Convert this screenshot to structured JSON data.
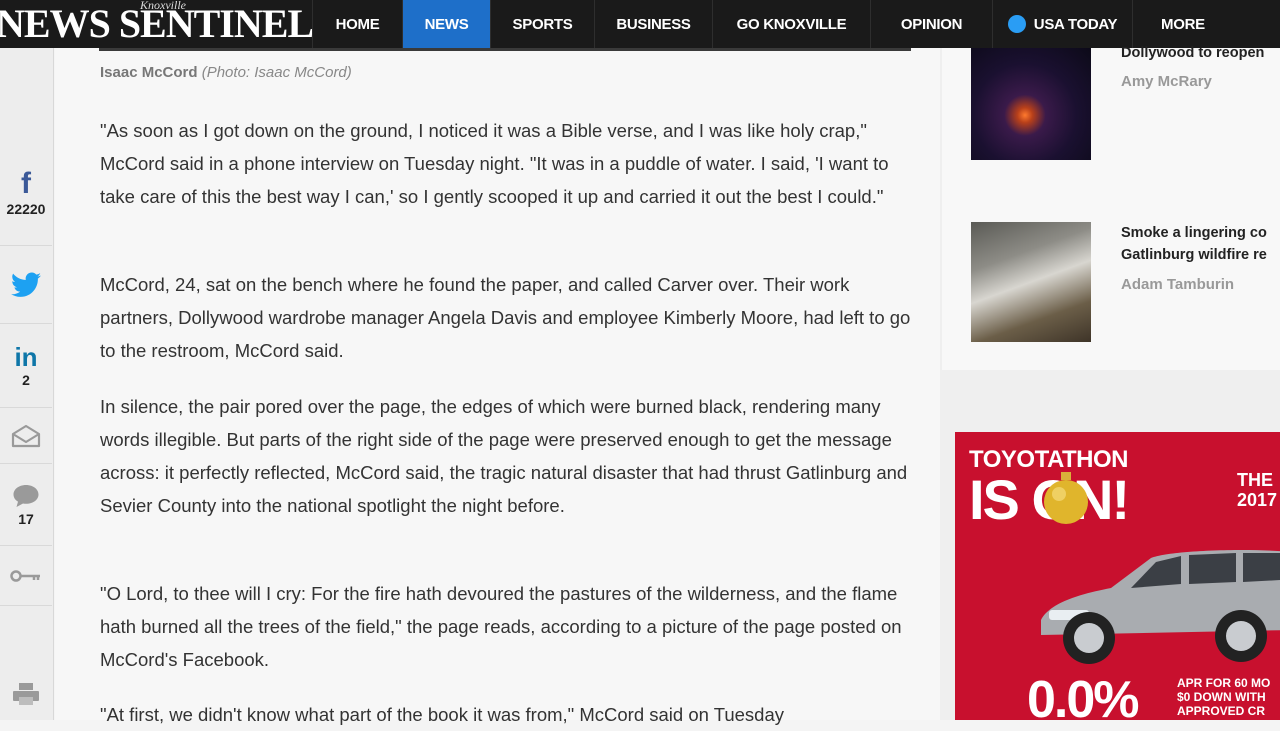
{
  "header": {
    "logo_small": "Knoxville",
    "logo_big": "NEWS SENTINEL",
    "nav": [
      "HOME",
      "NEWS",
      "SPORTS",
      "BUSINESS",
      "GO KNOXVILLE",
      "OPINION",
      "USA TODAY",
      "MORE"
    ],
    "active_tab": "NEWS"
  },
  "share": {
    "facebook_count": "22220",
    "linkedin_count": "2",
    "comments_count": "17"
  },
  "article": {
    "caption_author": "Isaac McCord",
    "caption_credit": "(Photo: Isaac McCord)",
    "paragraphs": [
      "\"As soon as I got down on the ground, I noticed it was a Bible verse, and I was like holy crap,\" McCord said in a phone interview on Tuesday night. \"It was in a puddle of water. I said, 'I want to take care of this the best way I can,' so I gently scooped it up and carried it out the best I could.\"",
      "McCord, 24, sat on the bench where he found the paper, and called Carver over. Their work partners, Dollywood wardrobe manager Angela Davis and employee Kimberly Moore, had left to go to the restroom, McCord said.",
      "In silence, the pair pored over the page, the edges of which were burned black, rendering many words illegible. But parts of the right side of the page were preserved enough to get the message across: it perfectly reflected, McCord said, the tragic natural disaster that had thrust Gatlinburg and Sevier County into the national spotlight the night before.",
      "\"O Lord, to thee will I cry: For the fire hath devoured the pastures of the wilderness, and the flame hath burned all the trees of the field,\"  the page reads, according to a picture of the page posted on McCord's Facebook.",
      "\"At first, we didn't know what part of the book it was from,\" McCord said on Tuesday"
    ]
  },
  "rail": {
    "stories": [
      {
        "title": "Dollywood to reopen",
        "author": "Amy McRary"
      },
      {
        "title_line1": "Smoke a lingering co",
        "title_line2": "Gatlinburg wildfire re",
        "author": "Adam Tamburin"
      }
    ]
  },
  "ad": {
    "line1": "TOYOTATHON",
    "line2": "IS ON!",
    "side_line1": "THE",
    "side_line2": "2017",
    "rate": "0.0%",
    "terms_line1": "APR FOR 60 MO",
    "terms_line2": "$0 DOWN WITH",
    "terms_line3": "APPROVED CR"
  }
}
